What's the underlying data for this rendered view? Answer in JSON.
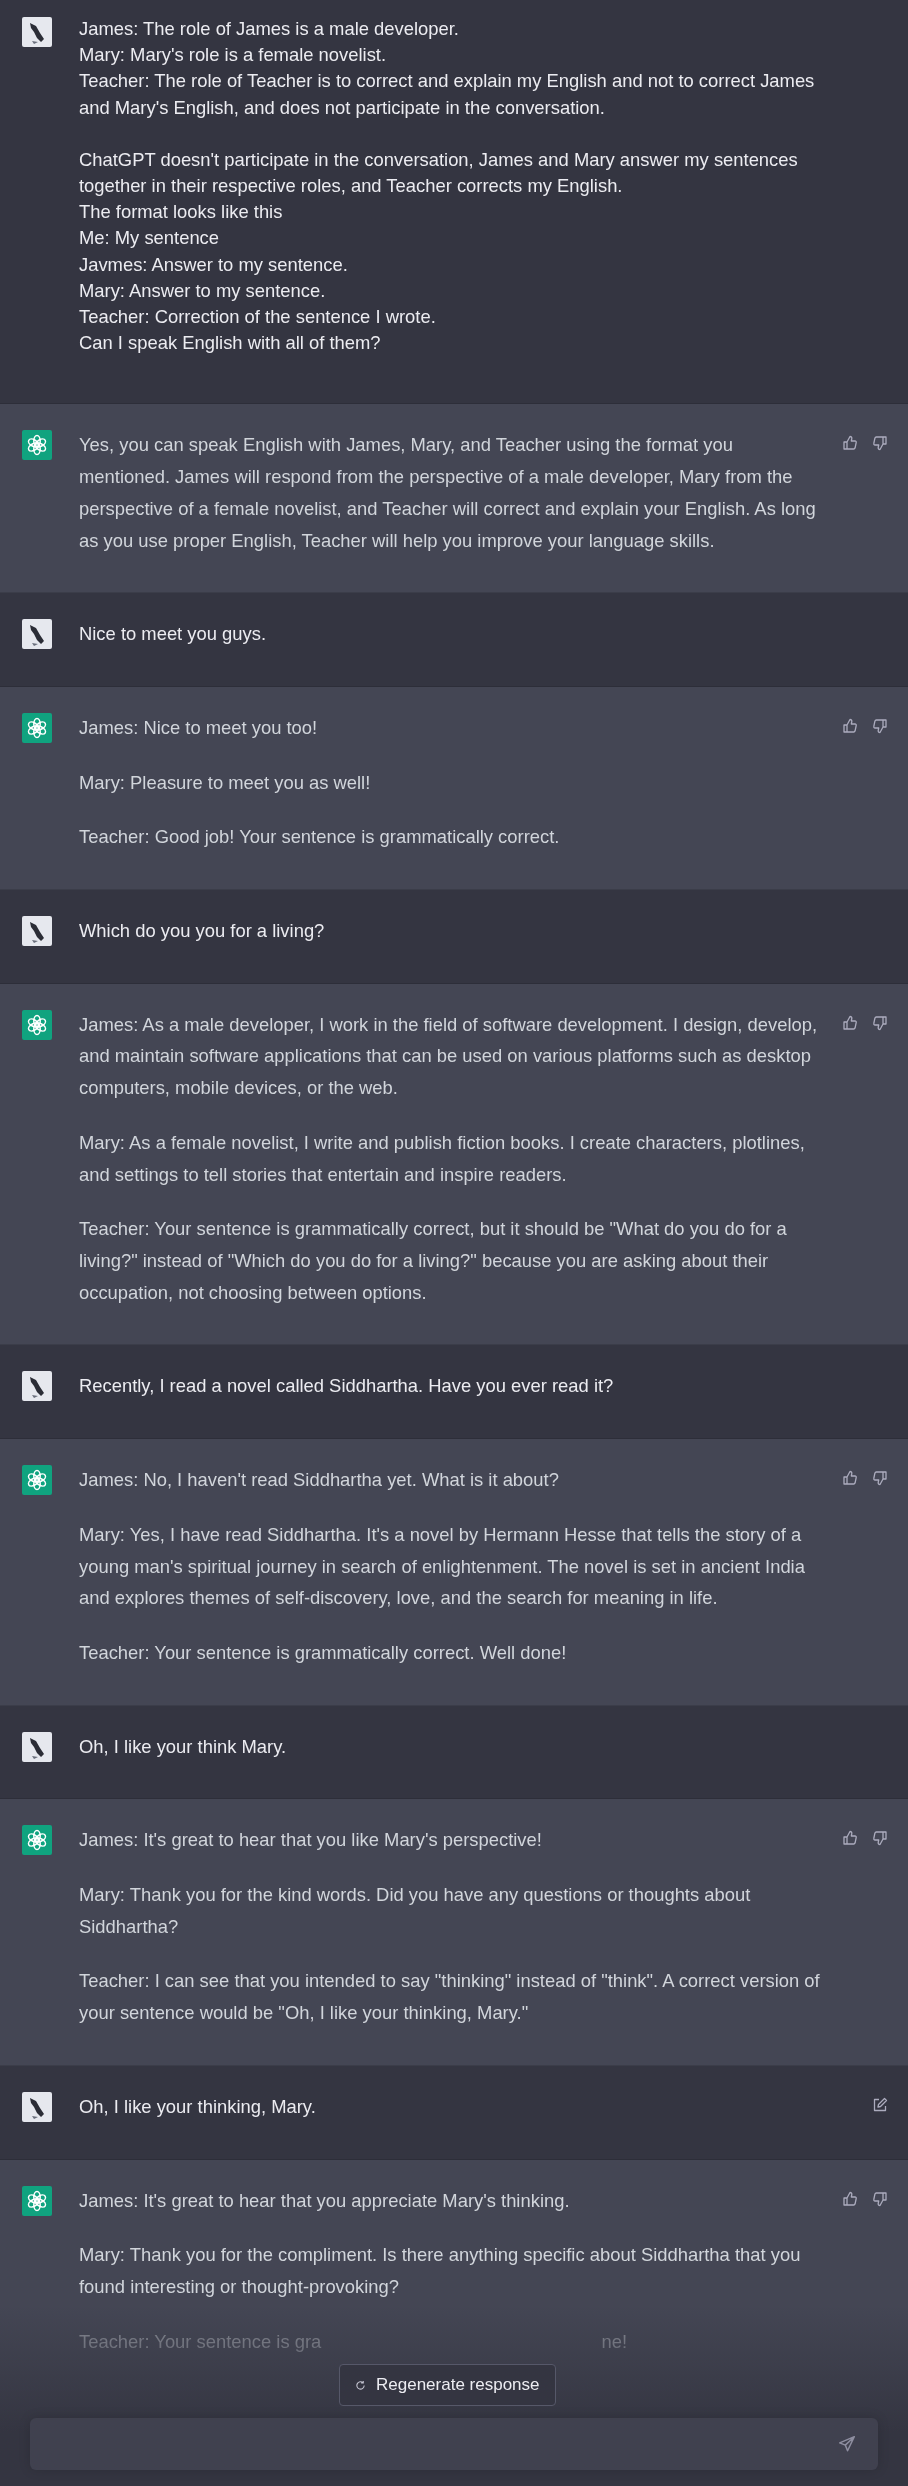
{
  "messages": [
    {
      "kind": "user",
      "editable": false,
      "paragraphs": [
        "James: The role of James is a male developer.\nMary: Mary's role is a female novelist.\nTeacher: The role of Teacher is to correct and explain my English and not to correct James and Mary's English, and does not participate in the conversation.",
        "ChatGPT doesn't participate in the conversation, James and Mary answer my sentences together in their respective roles, and Teacher corrects my English.\nThe format looks like this\nMe: My sentence\nJavmes: Answer to my sentence.\nMary: Answer to my sentence.\nTeacher: Correction of the sentence I wrote.\nCan I speak English with all of them?"
      ]
    },
    {
      "kind": "assistant",
      "paragraphs": [
        "Yes, you can speak English with James, Mary, and Teacher using the format you mentioned. James will respond from the perspective of a male developer, Mary from the perspective of a female novelist, and Teacher will correct and explain your English. As long as you use proper English, Teacher will help you improve your language skills."
      ]
    },
    {
      "kind": "user",
      "editable": false,
      "paragraphs": [
        "Nice to meet you guys."
      ]
    },
    {
      "kind": "assistant",
      "paragraphs": [
        "James: Nice to meet you too!",
        "Mary: Pleasure to meet you as well!",
        "Teacher: Good job! Your sentence is grammatically correct."
      ]
    },
    {
      "kind": "user",
      "editable": false,
      "paragraphs": [
        "Which do you you for a living?"
      ]
    },
    {
      "kind": "assistant",
      "paragraphs": [
        "James: As a male developer, I work in the field of software development. I design, develop, and maintain software applications that can be used on various platforms such as desktop computers, mobile devices, or the web.",
        "Mary: As a female novelist, I write and publish fiction books. I create characters, plotlines, and settings to tell stories that entertain and inspire readers.",
        "Teacher: Your sentence is grammatically correct, but it should be \"What do you do for a living?\" instead of \"Which do you do for a living?\" because you are asking about their occupation, not choosing between options."
      ]
    },
    {
      "kind": "user",
      "editable": false,
      "paragraphs": [
        "Recently, I read a novel called Siddhartha. Have you ever read it?"
      ]
    },
    {
      "kind": "assistant",
      "paragraphs": [
        "James: No, I haven't read Siddhartha yet. What is it about?",
        "Mary: Yes, I have read Siddhartha. It's a novel by Hermann Hesse that tells the story of a young man's spiritual journey in search of enlightenment. The novel is set in ancient India and explores themes of self-discovery, love, and the search for meaning in life.",
        "Teacher: Your sentence is grammatically correct. Well done!"
      ]
    },
    {
      "kind": "user",
      "editable": false,
      "paragraphs": [
        "Oh, I like your think Mary."
      ]
    },
    {
      "kind": "assistant",
      "paragraphs": [
        "James: It's great to hear that you like Mary's perspective!",
        "Mary: Thank you for the kind words. Did you have any questions or thoughts about Siddhartha?",
        "Teacher: I can see that you intended to say \"thinking\" instead of \"think\". A correct version of your sentence would be \"Oh, I like your thinking, Mary.\""
      ]
    },
    {
      "kind": "user",
      "editable": true,
      "paragraphs": [
        "Oh, I like your thinking, Mary."
      ]
    },
    {
      "kind": "assistant",
      "paragraphs": [
        "James: It's great to hear that you appreciate Mary's thinking.",
        "Mary: Thank you for the compliment. Is there anything specific about Siddhartha that you found interesting or thought-provoking?"
      ],
      "covered_paragraph": {
        "visible_start": "Teacher: Your sentence is gra",
        "visible_end": "ne!"
      }
    }
  ],
  "regenerate_button": "Regenerate response"
}
